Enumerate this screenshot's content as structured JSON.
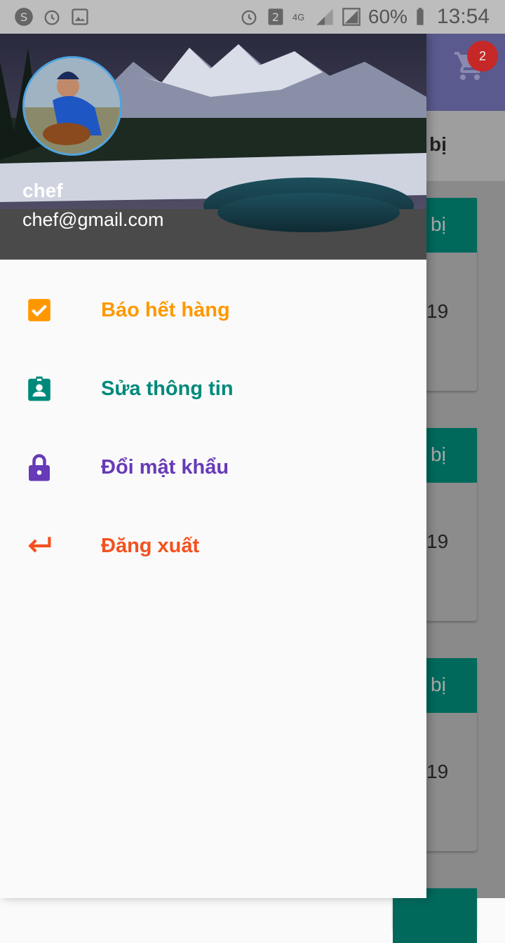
{
  "status_bar": {
    "battery_text": "60%",
    "time": "13:54",
    "sim_slot": "2",
    "network": "4G"
  },
  "background": {
    "cart_badge": "2",
    "tab_label_fragment": "bị",
    "card_header_fragment": "bị",
    "card_number_fragment": "19"
  },
  "drawer": {
    "user": {
      "name": "chef",
      "email": "chef@gmail.com"
    },
    "menu": [
      {
        "label": "Báo hết hàng",
        "icon": "checkbox-icon",
        "color": "#ff9800"
      },
      {
        "label": "Sửa thông tin",
        "icon": "id-badge-icon",
        "color": "#00897b"
      },
      {
        "label": "Đổi mật khẩu",
        "icon": "lock-icon",
        "color": "#673ab7"
      },
      {
        "label": "Đăng xuất",
        "icon": "logout-arrow-icon",
        "color": "#f4511e"
      }
    ]
  }
}
